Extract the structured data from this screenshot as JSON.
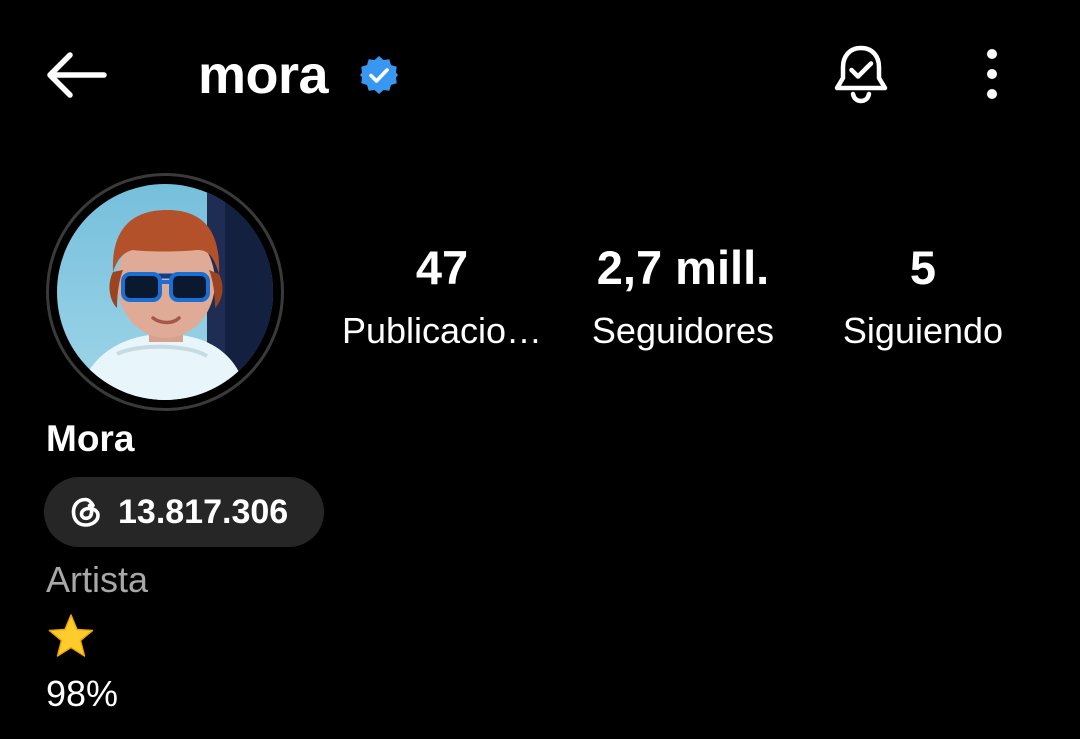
{
  "header": {
    "username": "mora",
    "verified_badge_color": "#3897F0",
    "icons": [
      "back-arrow-icon",
      "verified-badge-icon",
      "notification-bell-icon",
      "more-options-icon"
    ]
  },
  "profile": {
    "avatar": "profile-photo",
    "stats": [
      {
        "value": "47",
        "label": "Publicacio…"
      },
      {
        "value": "2,7 mill.",
        "label": "Seguidores"
      },
      {
        "value": "5",
        "label": "Siguiendo"
      }
    ],
    "display_name": "Mora",
    "threads": {
      "icon": "threads-icon",
      "count": "13.817.306"
    },
    "category": "Artista",
    "bio": {
      "emoji_icon": "star-icon",
      "line": "98%"
    }
  },
  "colors": {
    "background": "#000000",
    "text": "#FFFFFF",
    "secondary_text": "#A8A8A8",
    "pill_background": "#262626",
    "star": "#FFCC2E"
  }
}
